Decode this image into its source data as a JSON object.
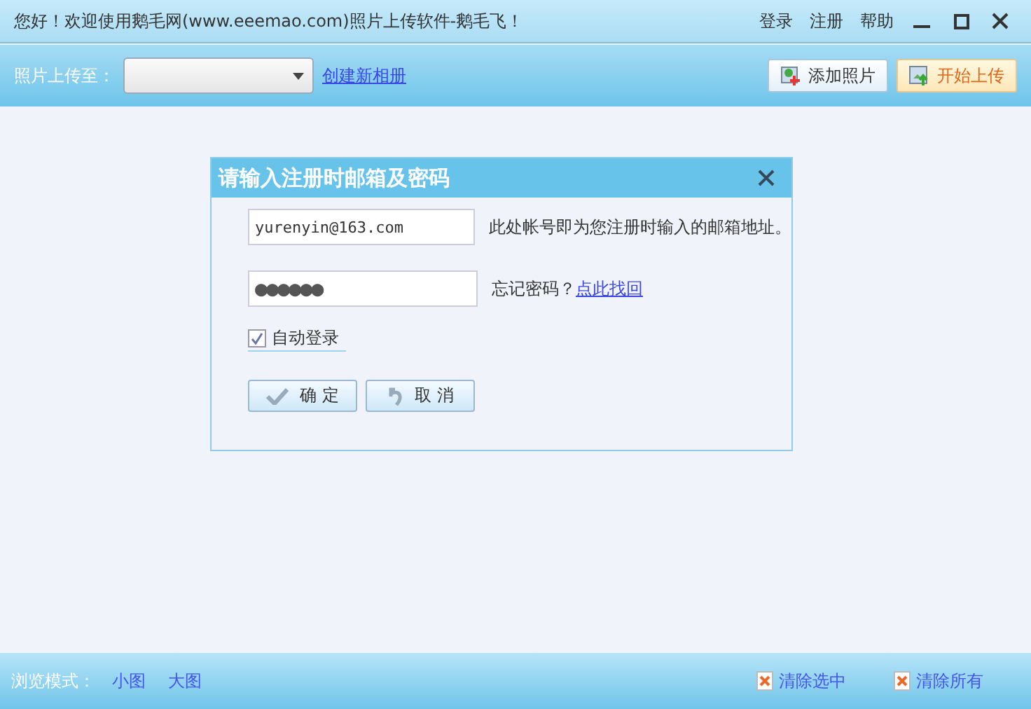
{
  "window": {
    "title": "您好！欢迎使用鹅毛网(www.eeemao.com)照片上传软件-鹅毛飞！",
    "menu": [
      "登录",
      "注册",
      "帮助"
    ]
  },
  "toolbar": {
    "upload_to_label": "照片上传至：",
    "create_album_link": "创建新相册",
    "add_photo_button": "添加照片",
    "start_upload_button": "开始上传"
  },
  "dialog": {
    "title": "请输入注册时邮箱及密码",
    "account": {
      "value": "yurenyin@163.com",
      "hint": "此处帐号即为您注册时输入的邮箱地址。"
    },
    "password": {
      "value": "●●●●●●",
      "hint": "忘记密码？",
      "link": "点此找回"
    },
    "auto_login": {
      "label": "自动登录",
      "checked": true
    },
    "buttons": [
      {
        "kind": "ok",
        "label": "确 定"
      },
      {
        "kind": "cancel",
        "label": "取 消"
      }
    ]
  },
  "footer": {
    "view_mode_label": "浏览模式：",
    "view_modes": [
      {
        "label": "小图",
        "selected": false
      },
      {
        "label": "大图",
        "selected": false
      }
    ],
    "actions": [
      "清除选中",
      "清除所有"
    ]
  }
}
